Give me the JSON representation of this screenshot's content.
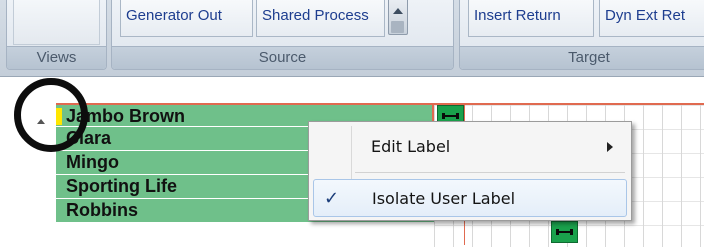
{
  "ribbon": {
    "groups": [
      {
        "label": "Views"
      },
      {
        "label": "Source"
      },
      {
        "label": "Target"
      }
    ],
    "source_buttons": [
      "Generator Out",
      "Shared Process"
    ],
    "target_buttons": [
      "Insert Return",
      "Dyn Ext Ret"
    ]
  },
  "tracks": [
    {
      "label": "Jambo Brown"
    },
    {
      "label": "Clara"
    },
    {
      "label": "Mingo"
    },
    {
      "label": "Sporting Life"
    },
    {
      "label": "Robbins"
    }
  ],
  "context_menu": {
    "items": [
      {
        "label": "Edit Label",
        "has_submenu": true
      },
      {
        "label": "Isolate User Label",
        "checked": true,
        "check_glyph": "✓"
      }
    ]
  },
  "colors": {
    "track_green": "#6fc08a",
    "clip_green": "#1aa14c",
    "marker_yellow": "#ffe600",
    "selection_outline": "#e06a50",
    "ribbon_text": "#1d3d8f"
  }
}
